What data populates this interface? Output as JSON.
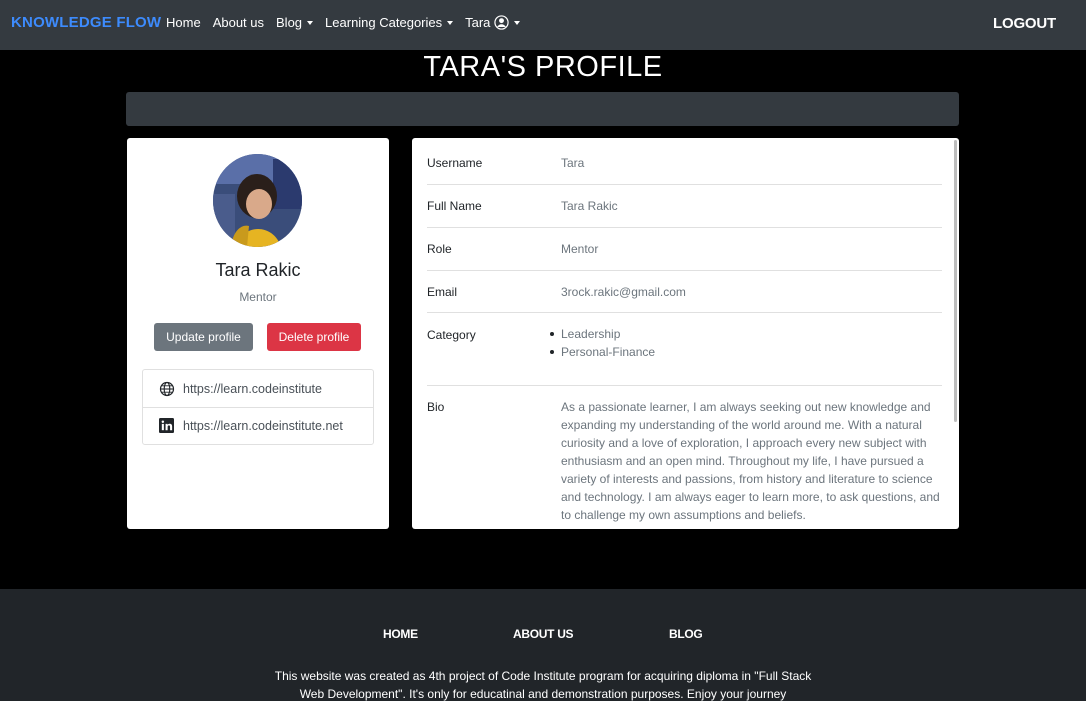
{
  "nav": {
    "brand": "KNOWLEDGE FLOW",
    "items": [
      {
        "label": "Home",
        "dropdown": false
      },
      {
        "label": "About us",
        "dropdown": false
      },
      {
        "label": "Blog",
        "dropdown": true
      },
      {
        "label": "Learning Categories",
        "dropdown": true
      },
      {
        "label": "Tara",
        "dropdown": true
      }
    ],
    "logout": "LOGOUT"
  },
  "page": {
    "title": "TARA'S PROFILE"
  },
  "profile": {
    "name": "Tara Rakic",
    "role": "Mentor",
    "update_button": "Update profile",
    "delete_button": "Delete profile",
    "links": [
      {
        "icon": "globe-icon",
        "url": "https://learn.codeinstitute"
      },
      {
        "icon": "linkedin-icon",
        "url": "https://learn.codeinstitute.net"
      }
    ]
  },
  "details": {
    "username": {
      "label": "Username",
      "value": "Tara"
    },
    "full_name": {
      "label": "Full Name",
      "value": "Tara Rakic"
    },
    "role": {
      "label": "Role",
      "value": "Mentor"
    },
    "email": {
      "label": "Email",
      "value": "3rock.rakic@gmail.com"
    },
    "category": {
      "label": "Category",
      "items": [
        "Leadership",
        "Personal-Finance"
      ]
    },
    "bio": {
      "label": "Bio",
      "value": "As a passionate learner, I am always seeking out new knowledge and expanding my understanding of the world around me. With a natural curiosity and a love of exploration, I approach every new subject with enthusiasm and an open mind. Throughout my life, I have pursued a variety of interests and passions, from history and literature to science and technology. I am always eager to learn more, to ask questions, and to challenge my own assumptions and beliefs."
    }
  },
  "footer": {
    "links": [
      "HOME",
      "ABOUT US",
      "BLOG"
    ],
    "text": "This website was created as 4th project of Code Institute program for acquiring diploma in \"Full Stack Web Development\". It's only for educatinal and demonstration purposes. Enjoy your journey"
  }
}
